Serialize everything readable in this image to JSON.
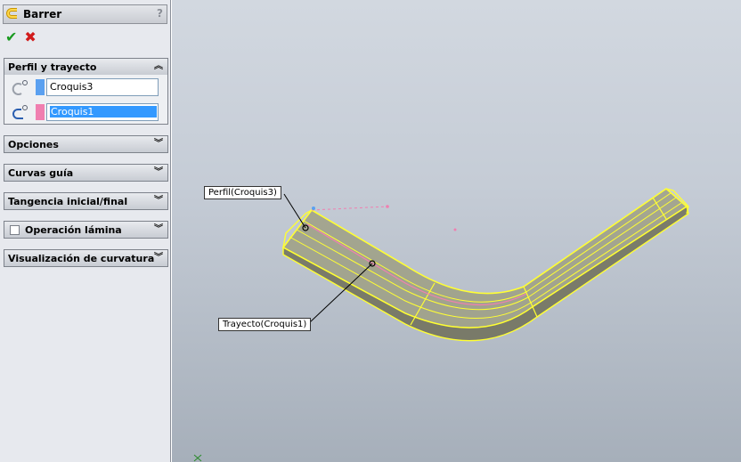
{
  "feature": {
    "title": "Barrer",
    "help_label": "?",
    "ok_label": "✔",
    "cancel_label": "✖"
  },
  "groups": {
    "profile_path": {
      "label": "Perfil y trayecto",
      "profile_value": "Croquis3",
      "path_value": "Croquis1",
      "profile_color": "#5aa0f0",
      "path_color": "#f07fb0"
    },
    "options": {
      "label": "Opciones"
    },
    "guide_curves": {
      "label": "Curvas guía"
    },
    "tangency": {
      "label": "Tangencia inicial/final"
    },
    "thin_feature": {
      "label": "Operación lámina",
      "checked": false
    },
    "curvature_display": {
      "label": "Visualización de curvatura"
    }
  },
  "viewport": {
    "callouts": {
      "profile": "Perfil(Croquis3)",
      "path": "Trayecto(Croquis1)"
    },
    "highlight_color": "#ffff33",
    "background_top": "#d2d8e0",
    "background_bottom": "#a6afba"
  }
}
